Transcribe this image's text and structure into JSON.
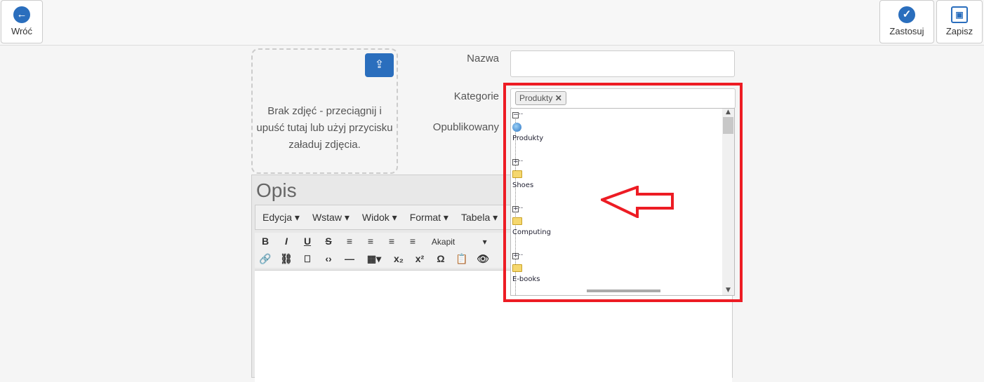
{
  "toolbar": {
    "back": "Wróć",
    "apply": "Zastosuj",
    "save": "Zapisz"
  },
  "dropzone": {
    "text": "Brak zdjęć - przeciągnij i upuść tutaj lub użyj przycisku załaduj zdjęcia."
  },
  "form": {
    "name_label": "Nazwa",
    "name_value": "",
    "categories_label": "Kategorie",
    "published_label": "Opublikowany",
    "selected_tag": "Produkty"
  },
  "tree": {
    "root": "Produkty",
    "children": [
      "Shoes",
      "Computing",
      "E-books"
    ]
  },
  "editor": {
    "title": "Opis",
    "menu": [
      "Edycja",
      "Wstaw",
      "Widok",
      "Format",
      "Tabela"
    ],
    "format_select": "Akapit"
  },
  "colors": {
    "accent": "#2a6ebd",
    "highlight": "#ed1c24"
  }
}
